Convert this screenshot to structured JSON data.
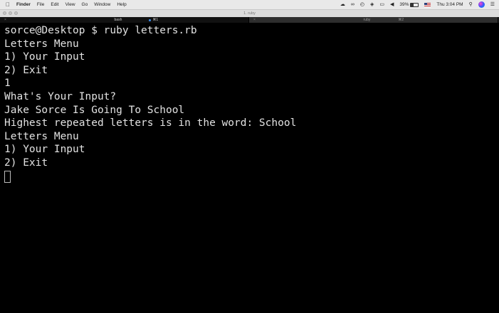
{
  "menubar": {
    "apple_icon": "apple-logo",
    "items": [
      "Finder",
      "File",
      "Edit",
      "View",
      "Go",
      "Window",
      "Help"
    ],
    "status": {
      "battery_percent": "39%",
      "battery_level": 0.39,
      "clock": "Thu 3:04 PM",
      "icons": [
        "cloud-icon",
        "pair-icon",
        "timemachine-icon",
        "wifi-icon",
        "airplay-icon",
        "volume-icon",
        "battery-icon",
        "flag-icon",
        "search-icon",
        "siri-icon",
        "list-icon"
      ]
    }
  },
  "window": {
    "title": "1. ruby"
  },
  "tabs": [
    {
      "label": "bash",
      "shortcut": "⌘1",
      "active": true
    },
    {
      "label": "ruby",
      "shortcut": "⌘2",
      "active": false
    }
  ],
  "terminal": {
    "lines": [
      "sorce@Desktop $ ruby letters.rb",
      "Letters Menu",
      "1) Your Input",
      "2) Exit",
      "1",
      "What's Your Input?",
      "Jake Sorce Is Going To School",
      "Highest repeated letters is in the word: School",
      "Letters Menu",
      "1) Your Input",
      "2) Exit"
    ]
  },
  "colors": {
    "terminal_bg": "#000000",
    "terminal_fg": "#e2e2e2",
    "menubar_bg": "#e9e9e9",
    "tab_indicator": "#3b8ef0"
  }
}
